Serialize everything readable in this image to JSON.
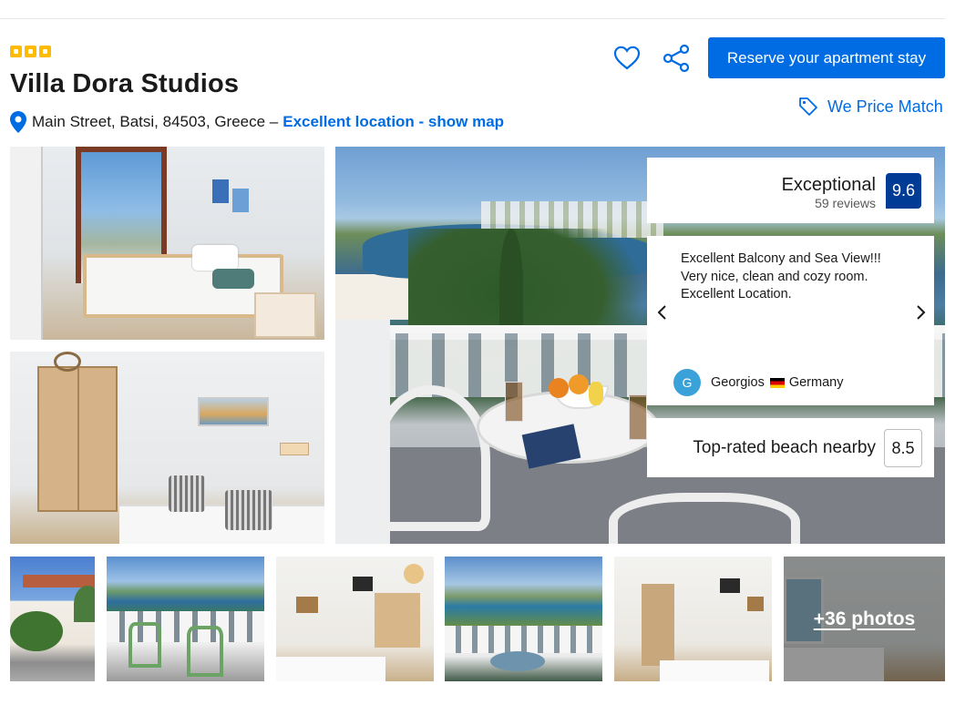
{
  "property": {
    "stars": 3,
    "name": "Villa Dora Studios",
    "address": "Main Street, Batsi, 84503, Greece –",
    "location_link": "Excellent location - show map"
  },
  "actions": {
    "favorite_icon": "heart-icon",
    "share_icon": "share-icon",
    "reserve_label": "Reserve your apartment stay",
    "price_match_label": "We Price Match",
    "price_match_icon": "tag-icon"
  },
  "score": {
    "label": "Exceptional",
    "reviews": "59 reviews",
    "value": "9.6"
  },
  "review": {
    "text": "Excellent Balcony and Sea View!!! Very nice, clean and cozy room. Excellent Location.",
    "avatar_letter": "G",
    "name": "Georgios",
    "country": "Germany"
  },
  "beach": {
    "label": "Top-rated beach nearby",
    "score": "8.5"
  },
  "gallery": {
    "more_photos": "+36 photos"
  },
  "colors": {
    "brand_blue": "#006ce4",
    "score_badge": "#003b95",
    "star_yellow": "#febb02"
  }
}
